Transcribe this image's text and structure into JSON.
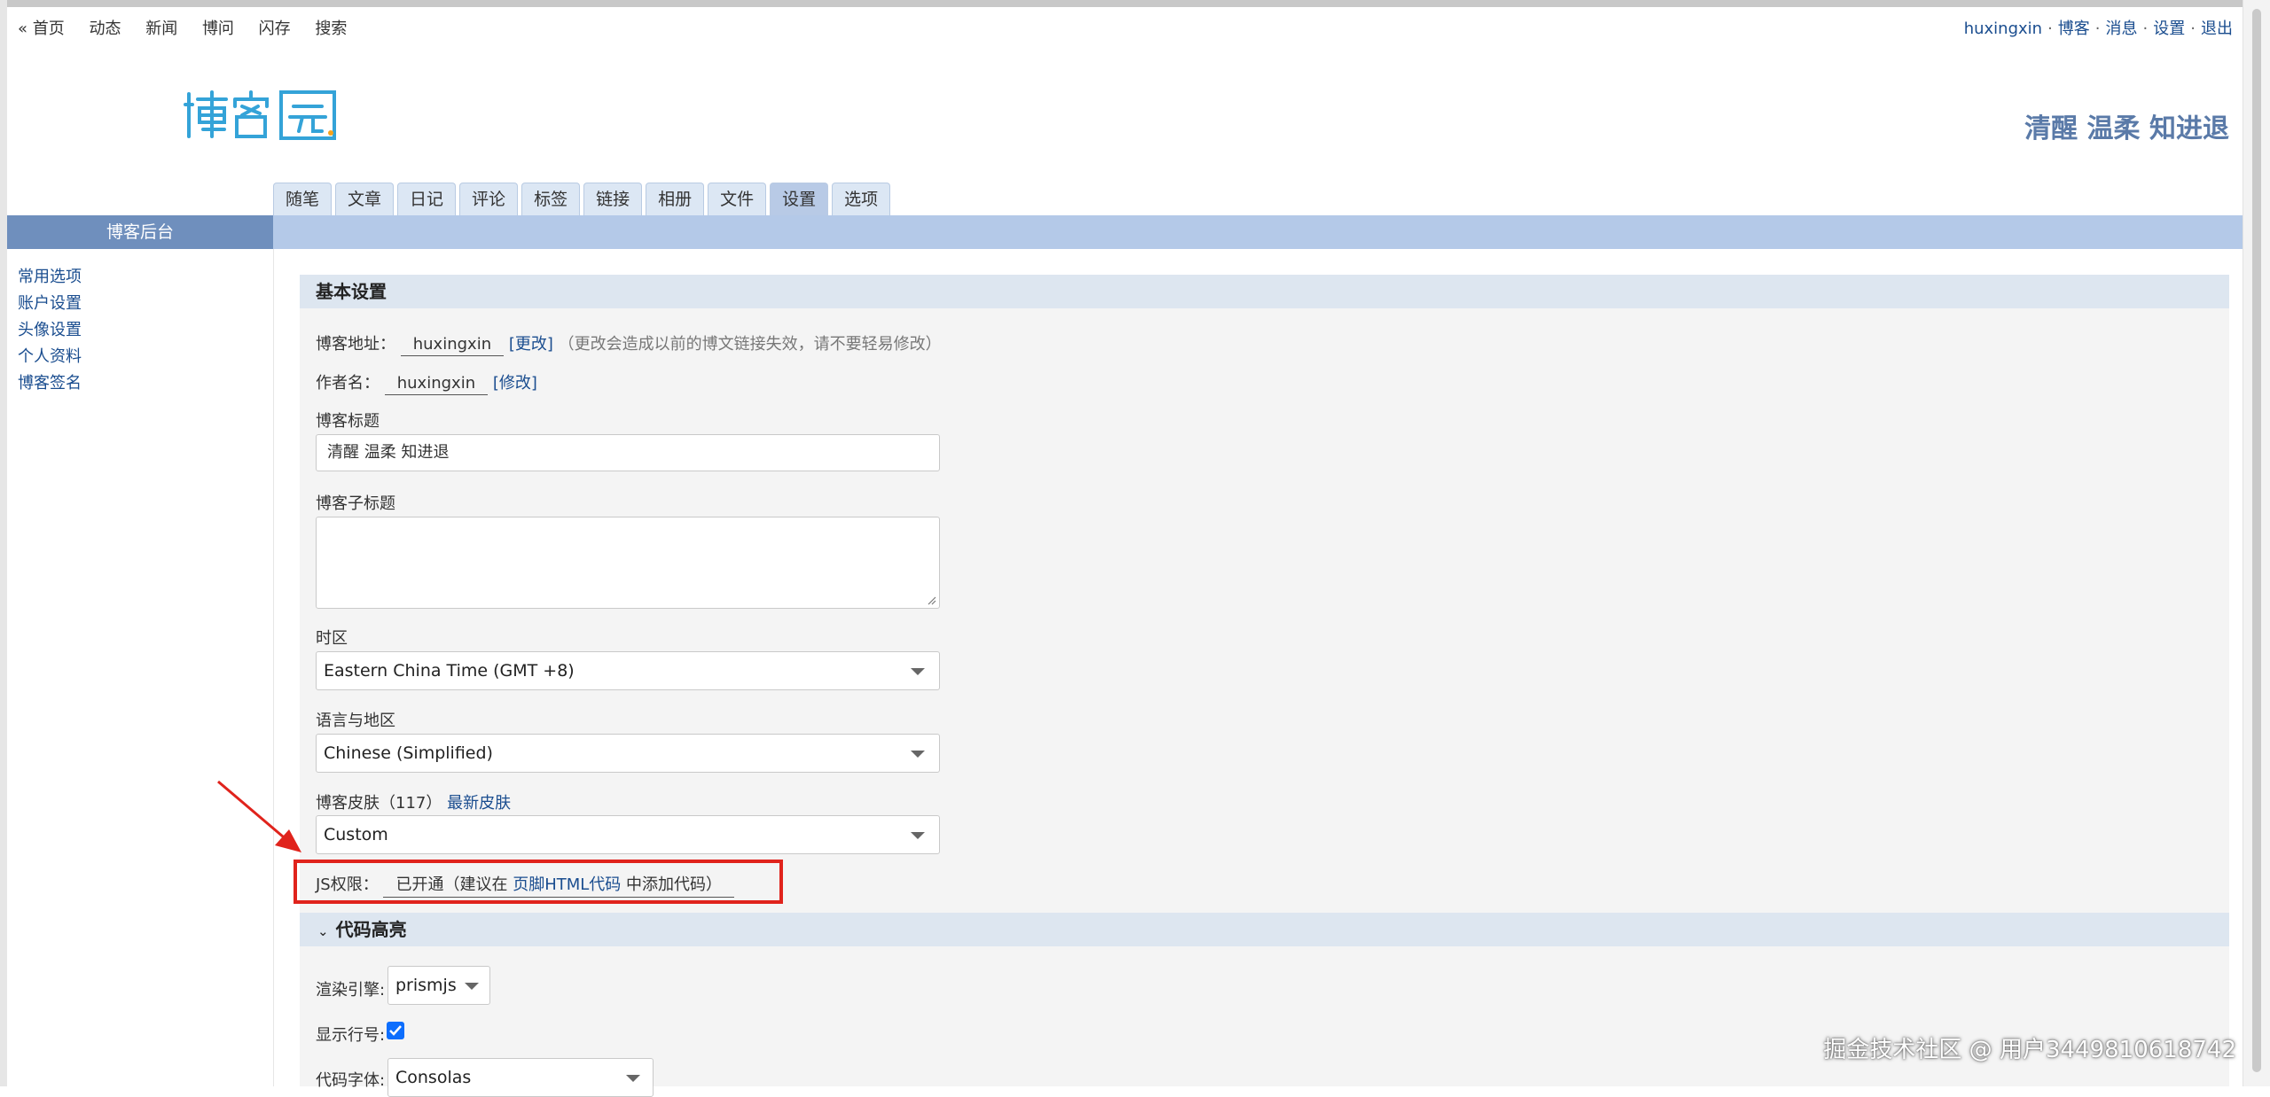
{
  "topnav": {
    "home": "« 首页",
    "news_feed": "动态",
    "news": "新闻",
    "qa": "博问",
    "flash": "闪存",
    "search": "搜索"
  },
  "usernav": {
    "username": "huxingxin",
    "blog": "博客",
    "messages": "消息",
    "settings": "设置",
    "logout": "退出",
    "separator": "·"
  },
  "header": {
    "blog_title": "清醒 温柔 知进退"
  },
  "tabs": [
    "随笔",
    "文章",
    "日记",
    "评论",
    "标签",
    "链接",
    "相册",
    "文件",
    "设置",
    "选项"
  ],
  "active_tab": "设置",
  "sidebar": {
    "title": "博客后台",
    "items": [
      "常用选项",
      "账户设置",
      "头像设置",
      "个人资料",
      "博客签名"
    ]
  },
  "basic": {
    "heading": "基本设置",
    "blog_address_label": "博客地址：",
    "blog_address_value": "huxingxin",
    "change_link": "[更改]",
    "change_note": "（更改会造成以前的博文链接失效，请不要轻易修改）",
    "author_label": "作者名：",
    "author_value": "huxingxin",
    "modify_link": "[修改]",
    "title_label": "博客标题",
    "title_value": "清醒 温柔 知进退",
    "subtitle_label": "博客子标题",
    "subtitle_value": "",
    "timezone_label": "时区",
    "timezone_value": "Eastern China Time (GMT +8)",
    "language_label": "语言与地区",
    "language_value": "Chinese (Simplified)",
    "skin_label": "博客皮肤（117）",
    "new_skins_link": "最新皮肤",
    "skin_value": "Custom",
    "js_label": "JS权限：",
    "js_status_pre": "已开通（建议在 ",
    "js_status_link": "页脚HTML代码",
    "js_status_post": " 中添加代码）"
  },
  "code": {
    "heading": "代码高亮",
    "engine_label": "渲染引擎:",
    "engine_value": "prismjs",
    "line_numbers_label": "显示行号:",
    "font_label": "代码字体:",
    "font_value": "Consolas"
  },
  "watermark": "掘金技术社区 @ 用户3449810618742",
  "colors": {
    "accent_blue": "#b4c9e8",
    "sidebar_head": "#6f8fbd",
    "link": "#1a4d8f",
    "annotation_red": "#e0231c"
  }
}
